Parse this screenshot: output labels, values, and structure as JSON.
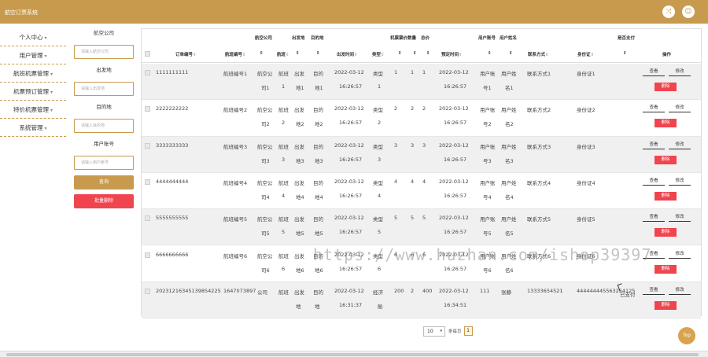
{
  "app": {
    "title": "航空订票系统"
  },
  "topbar": {
    "icon1": "shuffle-icon",
    "icon2": "user-icon"
  },
  "sidebar": {
    "items": [
      {
        "label": "个人中心"
      },
      {
        "label": "用户管理"
      },
      {
        "label": "航班机票管理"
      },
      {
        "label": "机票预订管理"
      },
      {
        "label": "特价机票管理"
      },
      {
        "label": "系统管理"
      }
    ]
  },
  "search": {
    "airline_label": "航空公司",
    "airline_placeholder": "请输入航空公司",
    "origin_label": "出发地",
    "origin_placeholder": "请输入出发地",
    "destination_label": "目的地",
    "destination_placeholder": "请输入目的地",
    "account_label": "用户账号",
    "account_placeholder": "请输入用户账号",
    "query_label": "查询",
    "batch_delete_label": "批量删除"
  },
  "table": {
    "headers": {
      "order_no": "订单编号",
      "flight_no": "航班编号",
      "airline": "航空公司",
      "flight": "航班",
      "origin": "出发地",
      "destination": "目的地",
      "depart_time": "出发时间",
      "type": "类型",
      "ticket_price": "机票票价",
      "quantity": "数量",
      "total": "总价",
      "book_time": "预定时间",
      "account": "用户账号",
      "username": "用户姓名",
      "contact": "联系方式",
      "id_card": "身份证",
      "paid": "是否支付",
      "actions": "操作"
    },
    "sort_mark": "⇕",
    "rows": [
      {
        "order_no": "1111111111",
        "flight_no": "航班编号1",
        "airline": [
          "航空公",
          "司1"
        ],
        "flight": [
          "航班",
          "1"
        ],
        "origin": [
          "出发",
          "地1"
        ],
        "destination": [
          "目的",
          "地1"
        ],
        "depart": [
          "2022-03-12",
          "16:26:57"
        ],
        "type": [
          "类型",
          "1"
        ],
        "price": "1",
        "qty": "1",
        "total": "1",
        "book": [
          "2022-03-12",
          "16:26:57"
        ],
        "account": [
          "用户账",
          "号1"
        ],
        "username": [
          "用户姓",
          "名1"
        ],
        "contact": "联系方式1",
        "id_card": "身份证1",
        "paid": ""
      },
      {
        "order_no": "2222222222",
        "flight_no": "航班编号2",
        "airline": [
          "航空公",
          "司2"
        ],
        "flight": [
          "航班",
          "2"
        ],
        "origin": [
          "出发",
          "地2"
        ],
        "destination": [
          "目的",
          "地2"
        ],
        "depart": [
          "2022-03-12",
          "16:26:57"
        ],
        "type": [
          "类型",
          "2"
        ],
        "price": "2",
        "qty": "2",
        "total": "2",
        "book": [
          "2022-03-12",
          "16:26:57"
        ],
        "account": [
          "用户账",
          "号2"
        ],
        "username": [
          "用户姓",
          "名2"
        ],
        "contact": "联系方式2",
        "id_card": "身份证2",
        "paid": ""
      },
      {
        "order_no": "3333333333",
        "flight_no": "航班编号3",
        "airline": [
          "航空公",
          "司3"
        ],
        "flight": [
          "航班",
          "3"
        ],
        "origin": [
          "出发",
          "地3"
        ],
        "destination": [
          "目的",
          "地3"
        ],
        "depart": [
          "2022-03-12",
          "16:26:57"
        ],
        "type": [
          "类型",
          "3"
        ],
        "price": "3",
        "qty": "3",
        "total": "3",
        "book": [
          "2022-03-12",
          "16:26:57"
        ],
        "account": [
          "用户账",
          "号3"
        ],
        "username": [
          "用户姓",
          "名3"
        ],
        "contact": "联系方式3",
        "id_card": "身份证3",
        "paid": ""
      },
      {
        "order_no": "4444444444",
        "flight_no": "航班编号4",
        "airline": [
          "航空公",
          "司4"
        ],
        "flight": [
          "航班",
          "4"
        ],
        "origin": [
          "出发",
          "地4"
        ],
        "destination": [
          "目的",
          "地4"
        ],
        "depart": [
          "2022-03-12",
          "16:26:57"
        ],
        "type": [
          "类型",
          "4"
        ],
        "price": "4",
        "qty": "4",
        "total": "4",
        "book": [
          "2022-03-12",
          "16:26:57"
        ],
        "account": [
          "用户账",
          "号4"
        ],
        "username": [
          "用户姓",
          "名4"
        ],
        "contact": "联系方式4",
        "id_card": "身份证4",
        "paid": ""
      },
      {
        "order_no": "5555555555",
        "flight_no": "航班编号5",
        "airline": [
          "航空公",
          "司5"
        ],
        "flight": [
          "航班",
          "5"
        ],
        "origin": [
          "出发",
          "地5"
        ],
        "destination": [
          "目的",
          "地5"
        ],
        "depart": [
          "2022-03-12",
          "16:26:57"
        ],
        "type": [
          "类型",
          "5"
        ],
        "price": "5",
        "qty": "5",
        "total": "5",
        "book": [
          "2022-03-12",
          "16:26:57"
        ],
        "account": [
          "用户账",
          "号5"
        ],
        "username": [
          "用户姓",
          "名5"
        ],
        "contact": "联系方式5",
        "id_card": "身份证5",
        "paid": ""
      },
      {
        "order_no": "6666666666",
        "flight_no": "航班编号6",
        "airline": [
          "航空公",
          "司6"
        ],
        "flight": [
          "航班",
          "6"
        ],
        "origin": [
          "出发",
          "地6"
        ],
        "destination": [
          "目的",
          "地6"
        ],
        "depart": [
          "2022-03-12",
          "16:26:57"
        ],
        "type": [
          "类型",
          "6"
        ],
        "price": "6",
        "qty": "6",
        "total": "6",
        "book": [
          "2022-03-12",
          "16:26:57"
        ],
        "account": [
          "用户账",
          "号6"
        ],
        "username": [
          "用户姓",
          "名6"
        ],
        "contact": "联系方式6",
        "id_card": "身份证6",
        "paid": ""
      },
      {
        "order_no": "20231216345139854225",
        "flight_no": "1647073897",
        "airline": [
          "公司",
          ""
        ],
        "flight": [
          "航班",
          ""
        ],
        "origin": [
          "出发",
          "地"
        ],
        "destination": [
          "目的",
          "地"
        ],
        "depart": [
          "2022-03-12",
          "16:31:37"
        ],
        "type": [
          "经济",
          "舱"
        ],
        "price": "200",
        "qty": "2",
        "total": "400",
        "book": [
          "2022-03-12",
          "16:34:51"
        ],
        "account": [
          "111",
          ""
        ],
        "username": [
          "张静",
          ""
        ],
        "contact": "13333654521",
        "id_card": "444444445563254125",
        "paid": "已支付"
      }
    ],
    "view_label": "查看",
    "edit_label": "修改",
    "delete_label": "删除"
  },
  "pager": {
    "page_size": "10",
    "per_page_label": "条每页",
    "current_page": "1"
  },
  "top_button": "Top",
  "watermark": "https://www.huzhan.com/ishop39397",
  "colors": {
    "primary": "#c89a4e",
    "danger": "#f0444e"
  }
}
